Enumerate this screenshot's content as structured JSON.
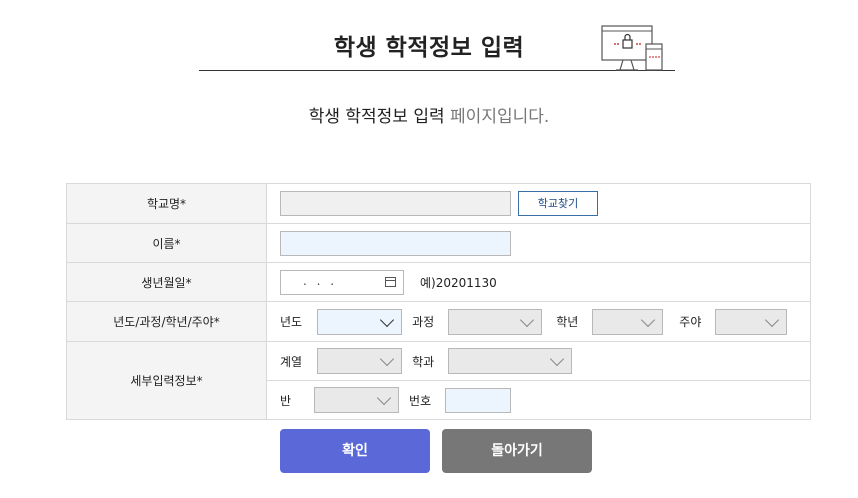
{
  "header": {
    "title": "학생 학적정보 입력",
    "subtitle_main": "학생 학적정보 입력",
    "subtitle_suffix": " 페이지입니다."
  },
  "form": {
    "school_label": "학교명*",
    "school_value": "",
    "find_school_button": "학교찾기",
    "name_label": "이름*",
    "name_value": "",
    "birth_label": "생년월일*",
    "birth_placeholder": ". . .",
    "birth_hint": "예)20201130",
    "year_row_label": "년도/과정/학년/주야*",
    "year_label": "년도",
    "course_label": "과정",
    "grade_label": "학년",
    "daynight_label": "주야",
    "detail_label": "세부입력정보*",
    "series_label": "계열",
    "dept_label": "학과",
    "class_label": "반",
    "number_label": "번호",
    "number_value": ""
  },
  "buttons": {
    "confirm": "확인",
    "back": "돌아가기"
  },
  "colors": {
    "confirm_bg": "#5b69d8",
    "back_bg": "#777777",
    "input_blue": "#ecf5fe",
    "input_gray": "#f0f0f0"
  }
}
